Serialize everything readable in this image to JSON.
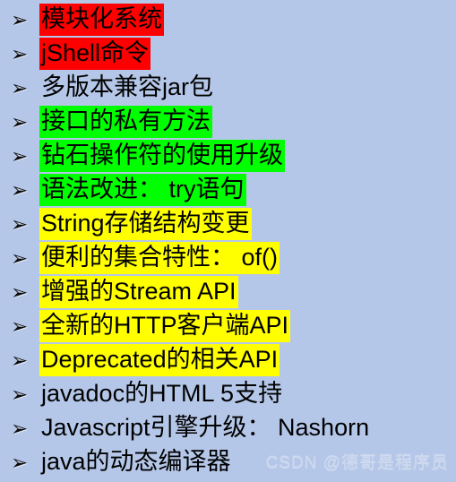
{
  "slide": {
    "background_color": "#b5c7e8",
    "bullet_glyph": "➢",
    "bullet_icon_name": "arrowhead-bullet-icon",
    "highlight_colors": {
      "red": "#ff0000",
      "green": "#00ff00",
      "yellow": "#ffff00",
      "none": "transparent"
    },
    "items": [
      {
        "text": "模块化系统",
        "highlight": "red"
      },
      {
        "text": "jShell命令",
        "highlight": "red"
      },
      {
        "text": "多版本兼容jar包",
        "highlight": "none"
      },
      {
        "text": "接口的私有方法",
        "highlight": "green"
      },
      {
        "text": "钻石操作符的使用升级",
        "highlight": "green"
      },
      {
        "text": "语法改进： try语句",
        "highlight": "green"
      },
      {
        "text": "String存储结构变更",
        "highlight": "yellow"
      },
      {
        "text": "便利的集合特性： of()",
        "highlight": "yellow"
      },
      {
        "text": "增强的Stream API",
        "highlight": "yellow"
      },
      {
        "text": "全新的HTTP客户端API",
        "highlight": "yellow"
      },
      {
        "text": "Deprecated的相关API",
        "highlight": "yellow"
      },
      {
        "text": "javadoc的HTML 5支持",
        "highlight": "none"
      },
      {
        "text": "Javascript引擎升级： Nashorn",
        "highlight": "none"
      },
      {
        "text": "java的动态编译器",
        "highlight": "none"
      }
    ],
    "watermark": "CSDN @德哥是程序员"
  }
}
